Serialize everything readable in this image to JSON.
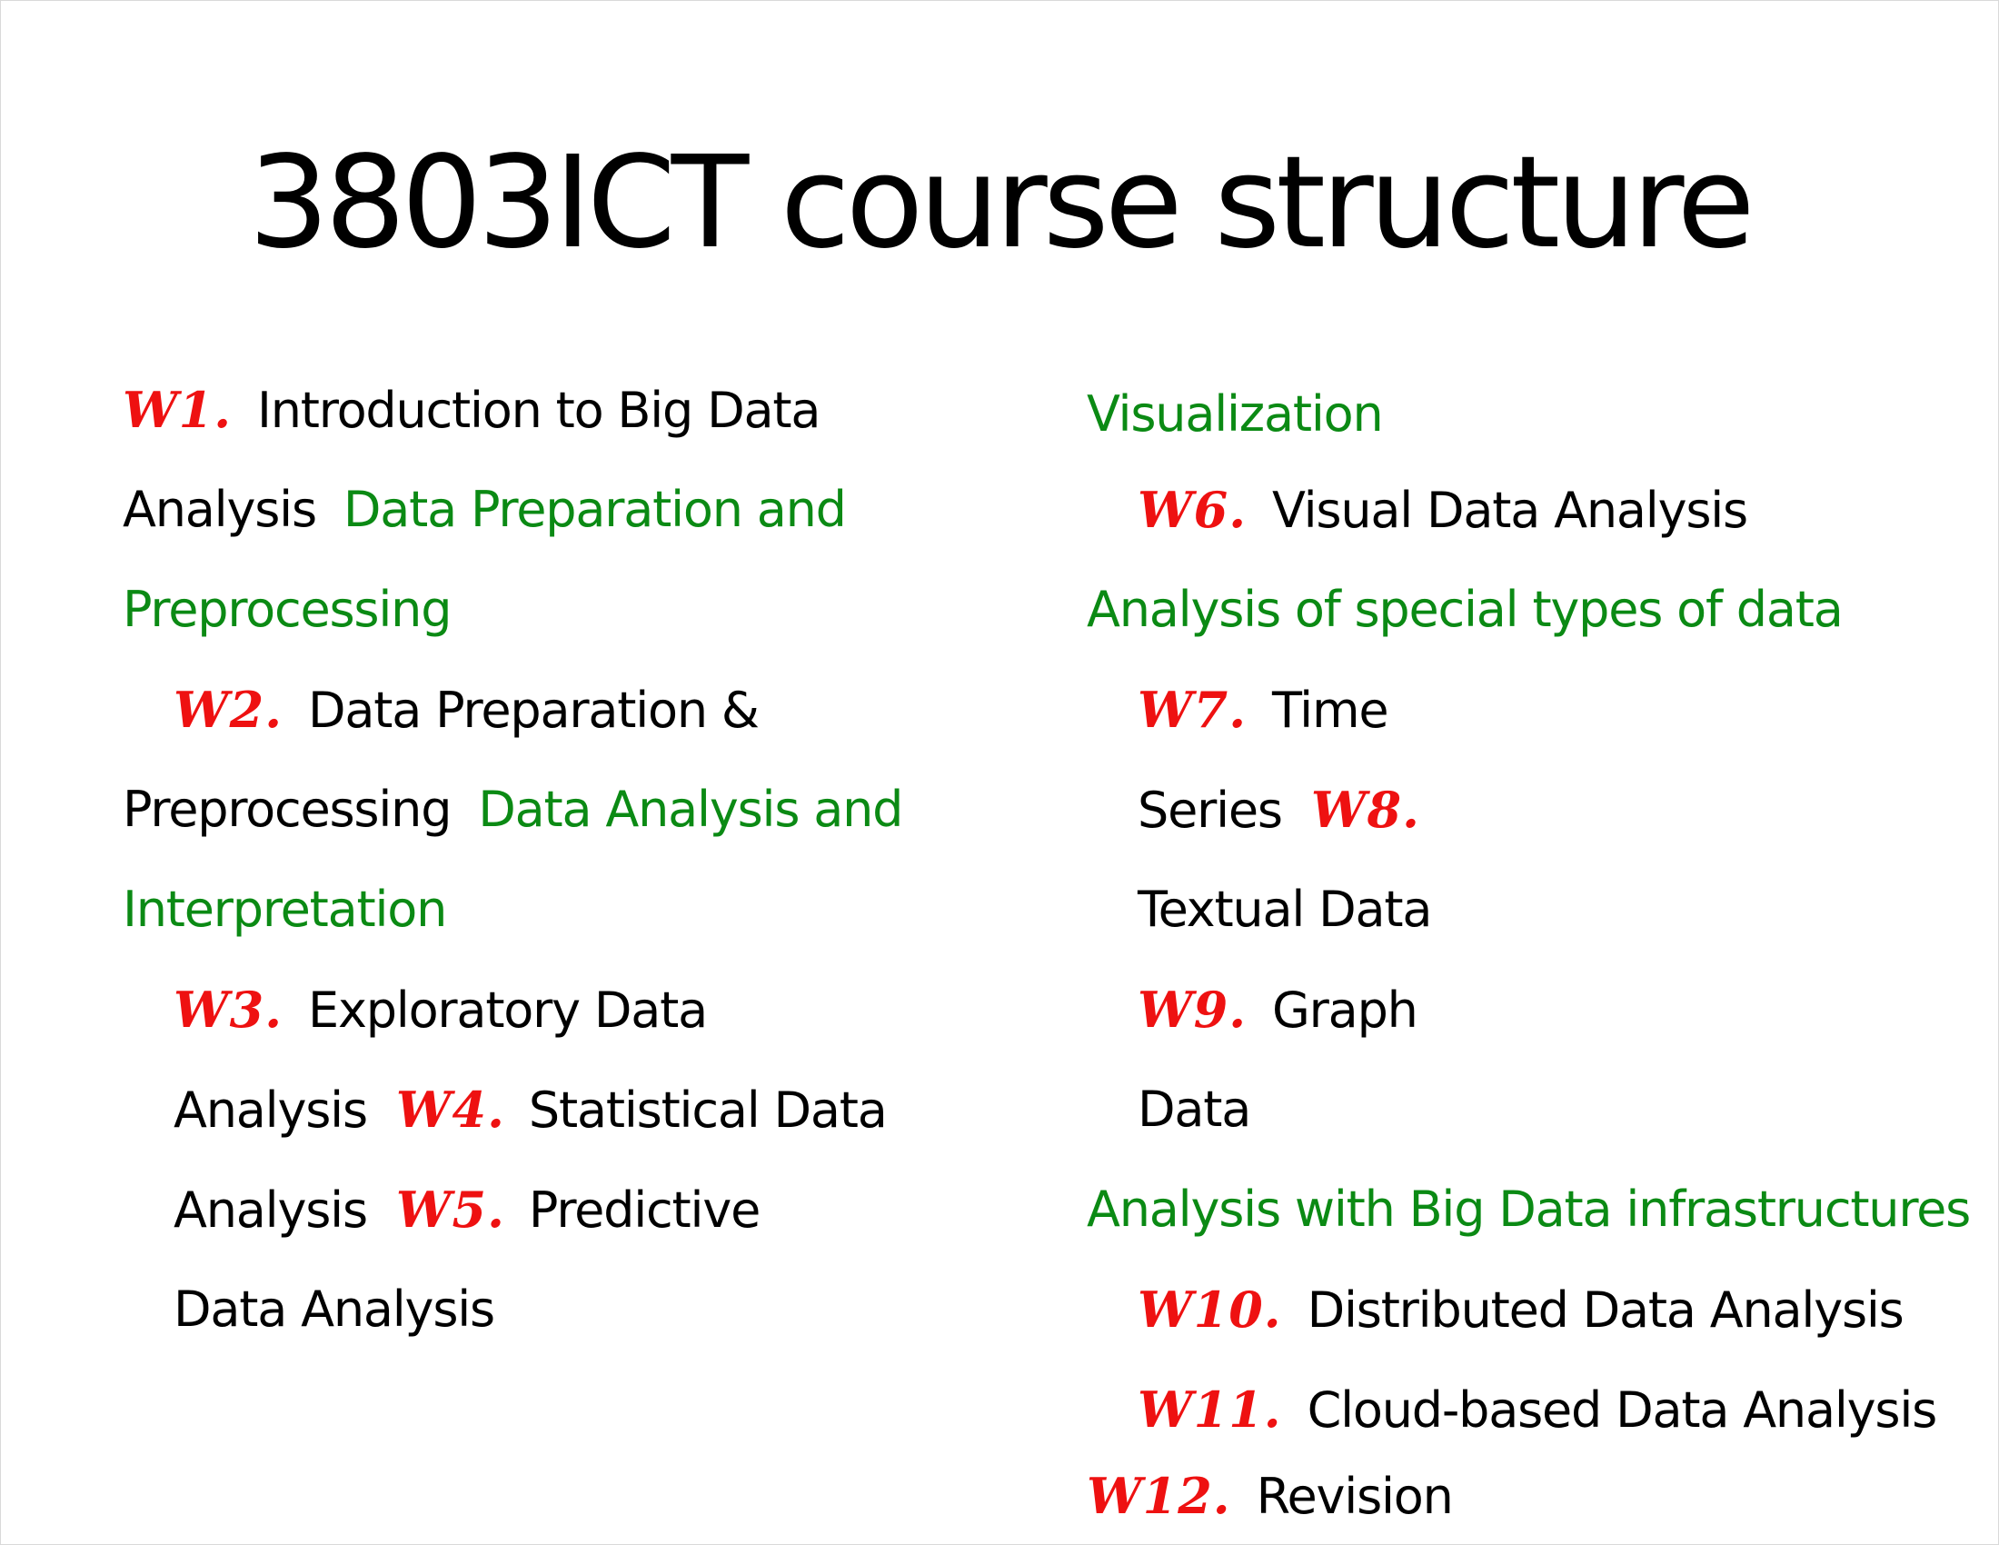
{
  "slide": {
    "title": "3803ICT course structure",
    "colors": {
      "week_label": "#ee1111",
      "section_heading": "#0b8a14",
      "body_text": "#000000"
    },
    "left_column": {
      "line1": {
        "week": "W1.",
        "text": "Introduction to Big Data"
      },
      "line2": {
        "text": "Analysis",
        "section": "Data Preparation and"
      },
      "line3": {
        "section": "Preprocessing"
      },
      "line4": {
        "week": "W2.",
        "text": "Data Preparation &"
      },
      "line5": {
        "text": "Preprocessing",
        "section": "Data Analysis and"
      },
      "line6": {
        "section": "Interpretation"
      },
      "line7": {
        "week": "W3.",
        "text": "Exploratory Data"
      },
      "line8": {
        "text": "Analysis",
        "week": "W4.",
        "text2": "Statistical Data"
      },
      "line9": {
        "text": "Analysis",
        "week": "W5.",
        "text2": "Predictive"
      },
      "line10": {
        "text": "Data Analysis"
      }
    },
    "right_column": {
      "line1": {
        "section": "Visualization"
      },
      "line2": {
        "week": "W6.",
        "text": "Visual Data Analysis"
      },
      "line3": {
        "section": "Analysis of special types of data"
      },
      "line4": {
        "week": "W7.",
        "text": "Time"
      },
      "line5": {
        "text": "Series",
        "week": "W8."
      },
      "line6": {
        "text": "Textual Data"
      },
      "line7": {
        "week": "W9.",
        "text": "Graph"
      },
      "line8": {
        "text": "Data"
      },
      "line9": {
        "section": "Analysis with Big Data infrastructures"
      },
      "line10": {
        "week": "W10.",
        "text": "Distributed Data Analysis"
      },
      "line11": {
        "week": "W11.",
        "text": "Cloud-based Data Analysis"
      },
      "line12": {
        "week": "W12.",
        "text": "Revision"
      }
    }
  }
}
